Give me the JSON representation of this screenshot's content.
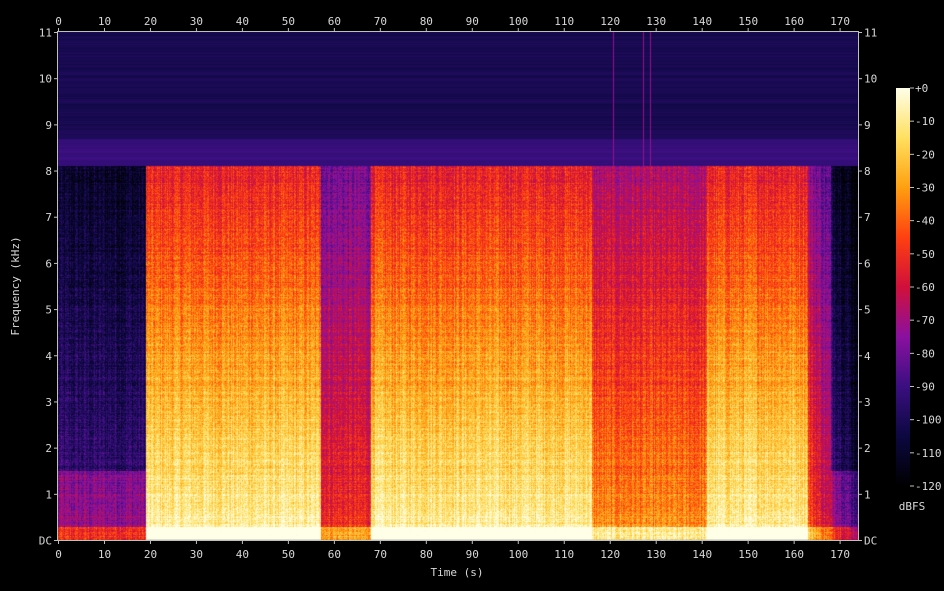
{
  "chart_data": {
    "type": "heatmap",
    "xlabel": "Time (s)",
    "ylabel": "Frequency (kHz)",
    "xlim": [
      0,
      174
    ],
    "ylim": [
      0,
      11
    ],
    "x_ticks": [
      "0",
      "10",
      "20",
      "30",
      "40",
      "50",
      "60",
      "70",
      "80",
      "90",
      "100",
      "110",
      "120",
      "130",
      "140",
      "150",
      "160",
      "170"
    ],
    "y_ticks": [
      "DC",
      "1",
      "2",
      "3",
      "4",
      "5",
      "6",
      "7",
      "8",
      "9",
      "10",
      "11"
    ],
    "colorbar": {
      "label": "dBFS",
      "range": [
        -120,
        0
      ],
      "ticks": [
        "+0",
        "-10",
        "-20",
        "-30",
        "-40",
        "-50",
        "-60",
        "-70",
        "-80",
        "-90",
        "-100",
        "-110",
        "-120"
      ]
    },
    "lowpass_cutoff_khz": 8.1,
    "segments": [
      {
        "start_s": 0,
        "end_s": 19,
        "level": "quiet intro"
      },
      {
        "start_s": 19,
        "end_s": 57,
        "level": "loud"
      },
      {
        "start_s": 57,
        "end_s": 68,
        "level": "dip"
      },
      {
        "start_s": 68,
        "end_s": 116,
        "level": "loud"
      },
      {
        "start_s": 116,
        "end_s": 141,
        "level": "mid-band dip"
      },
      {
        "start_s": 141,
        "end_s": 154,
        "level": "loud"
      },
      {
        "start_s": 154,
        "end_s": 163,
        "level": "loud"
      },
      {
        "start_s": 163,
        "end_s": 174,
        "level": "fade out"
      }
    ]
  },
  "colors": {
    "background": "#000000",
    "axis": "#c0c0c0",
    "colormap": [
      "#000000",
      "#0c0840",
      "#3a0f80",
      "#8a10a0",
      "#d0103a",
      "#ff4010",
      "#ffa010",
      "#ffe060",
      "#ffffe8"
    ]
  }
}
